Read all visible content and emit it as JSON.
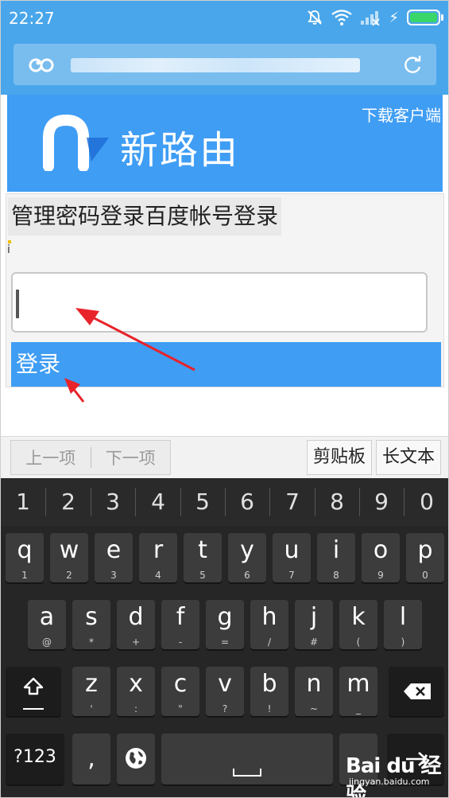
{
  "status_bar": {
    "time": "22:27",
    "icons": [
      "mute-icon",
      "wifi-icon",
      "signal-icon",
      "battery-icon"
    ],
    "battery_color": "#39d66a"
  },
  "browser": {
    "url_icon": "incognito-glasses-icon",
    "refresh_icon": "refresh-icon",
    "url_blurred": true
  },
  "header": {
    "logo_text": "新路由",
    "download_label": "下载客户端",
    "bg_color": "#3f9df4"
  },
  "login": {
    "tab_password": "管理密码登录",
    "tab_baidu": "百度帐号登录",
    "stray_char": "i",
    "password_value": "",
    "login_label": "登录",
    "button_color": "#3f9df4"
  },
  "keyboard": {
    "nav_prev": "上一项",
    "nav_next": "下一项",
    "clipboard": "剪贴板",
    "long_text": "长文本",
    "numbers": [
      "1",
      "2",
      "3",
      "4",
      "5",
      "6",
      "7",
      "8",
      "9",
      "0"
    ],
    "row1": [
      {
        "k": "q",
        "s": "1"
      },
      {
        "k": "w",
        "s": "2"
      },
      {
        "k": "e",
        "s": "3"
      },
      {
        "k": "r",
        "s": "4"
      },
      {
        "k": "t",
        "s": "5"
      },
      {
        "k": "y",
        "s": "6"
      },
      {
        "k": "u",
        "s": "7"
      },
      {
        "k": "i",
        "s": "8"
      },
      {
        "k": "o",
        "s": "9"
      },
      {
        "k": "p",
        "s": "0"
      }
    ],
    "row2": [
      {
        "k": "a",
        "s": "@"
      },
      {
        "k": "s",
        "s": "*"
      },
      {
        "k": "d",
        "s": "+"
      },
      {
        "k": "f",
        "s": "-"
      },
      {
        "k": "g",
        "s": "="
      },
      {
        "k": "h",
        "s": "/"
      },
      {
        "k": "j",
        "s": "#"
      },
      {
        "k": "k",
        "s": "("
      },
      {
        "k": "l",
        "s": ")"
      }
    ],
    "row3": [
      {
        "k": "z",
        "s": "'"
      },
      {
        "k": "x",
        "s": ":"
      },
      {
        "k": "c",
        "s": "\""
      },
      {
        "k": "v",
        "s": "?"
      },
      {
        "k": "b",
        "s": "!"
      },
      {
        "k": "n",
        "s": "~"
      },
      {
        "k": "m",
        "s": "_"
      }
    ],
    "sym_label": "?123",
    "comma_label": ","
  },
  "watermark": {
    "logo": "Bai du 经验",
    "sub": "jingyan.baidu.com"
  }
}
